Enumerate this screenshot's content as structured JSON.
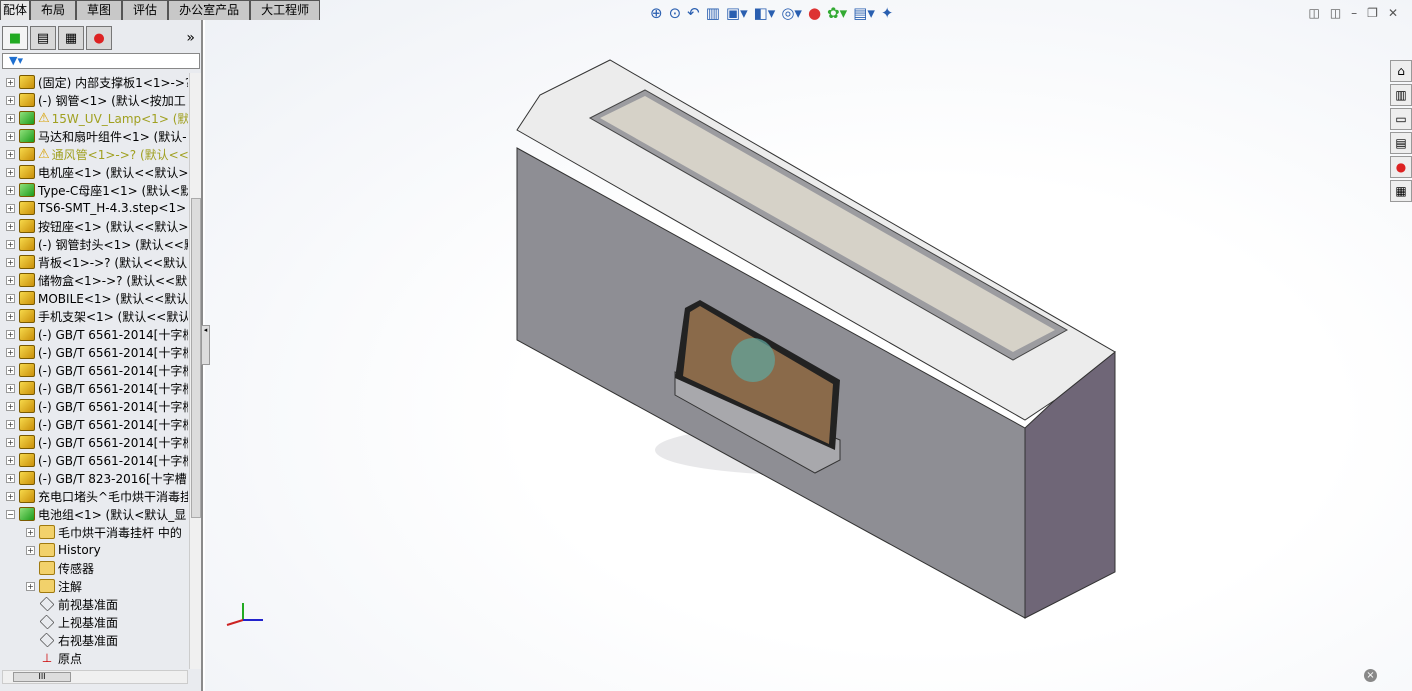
{
  "tabs": [
    "配体",
    "布局",
    "草图",
    "评估",
    "办公室产品",
    "大工程师"
  ],
  "tree": [
    {
      "label": "(固定) 内部支撑板1<1>->?",
      "icon": "part",
      "exp": "+"
    },
    {
      "label": "(-) 钢管<1> (默认<按加工",
      "icon": "part",
      "exp": "+"
    },
    {
      "label": "15W_UV_Lamp<1> (默",
      "icon": "assembly",
      "exp": "+",
      "warn": true
    },
    {
      "label": "马达和扇叶组件<1> (默认-",
      "icon": "assembly",
      "exp": "+"
    },
    {
      "label": "通风管<1>->? (默认<<",
      "icon": "part",
      "exp": "+",
      "warn": true
    },
    {
      "label": "电机座<1> (默认<<默认>",
      "icon": "part",
      "exp": "+"
    },
    {
      "label": "Type-C母座1<1> (默认<默",
      "icon": "assembly",
      "exp": "+"
    },
    {
      "label": "TS6-SMT_H-4.3.step<1>",
      "icon": "part",
      "exp": "+"
    },
    {
      "label": "按钮座<1> (默认<<默认>",
      "icon": "part",
      "exp": "+"
    },
    {
      "label": "(-) 钢管封头<1> (默认<<默",
      "icon": "part",
      "exp": "+"
    },
    {
      "label": "背板<1>->? (默认<<默认",
      "icon": "part",
      "exp": "+"
    },
    {
      "label": "储物盒<1>->? (默认<<默",
      "icon": "part",
      "exp": "+"
    },
    {
      "label": "MOBILE<1> (默认<<默认",
      "icon": "part",
      "exp": "+"
    },
    {
      "label": "手机支架<1> (默认<<默认",
      "icon": "part",
      "exp": "+"
    },
    {
      "label": "(-) GB/T 6561-2014[十字槽",
      "icon": "part",
      "exp": "+"
    },
    {
      "label": "(-) GB/T 6561-2014[十字槽",
      "icon": "part",
      "exp": "+"
    },
    {
      "label": "(-) GB/T 6561-2014[十字槽",
      "icon": "part",
      "exp": "+"
    },
    {
      "label": "(-) GB/T 6561-2014[十字槽",
      "icon": "part",
      "exp": "+"
    },
    {
      "label": "(-) GB/T 6561-2014[十字槽",
      "icon": "part",
      "exp": "+"
    },
    {
      "label": "(-) GB/T 6561-2014[十字槽",
      "icon": "part",
      "exp": "+"
    },
    {
      "label": "(-) GB/T 6561-2014[十字槽",
      "icon": "part",
      "exp": "+"
    },
    {
      "label": "(-) GB/T 6561-2014[十字槽",
      "icon": "part",
      "exp": "+"
    },
    {
      "label": "(-) GB/T 823-2016[十字槽",
      "icon": "part",
      "exp": "+"
    },
    {
      "label": "充电口堵头^毛巾烘干消毒挂",
      "icon": "part",
      "exp": "+"
    },
    {
      "label": "电池组<1> (默认<默认_显",
      "icon": "assembly",
      "exp": "-"
    },
    {
      "label": "毛巾烘干消毒挂杆 中的",
      "icon": "folder",
      "exp": "+",
      "indent": 1
    },
    {
      "label": "History",
      "icon": "folder",
      "exp": "+",
      "indent": 1
    },
    {
      "label": "传感器",
      "icon": "folder",
      "exp": "",
      "indent": 1
    },
    {
      "label": "注解",
      "icon": "folder",
      "exp": "+",
      "indent": 1
    },
    {
      "label": "前视基准面",
      "icon": "plane",
      "exp": "",
      "indent": 1
    },
    {
      "label": "上视基准面",
      "icon": "plane",
      "exp": "",
      "indent": 1
    },
    {
      "label": "右视基准面",
      "icon": "plane",
      "exp": "",
      "indent": 1
    },
    {
      "label": "原点",
      "icon": "origin",
      "exp": "",
      "indent": 1
    }
  ],
  "colors": {
    "front": "#8e8e94",
    "side": "#6f6677",
    "top": "#ececec"
  }
}
